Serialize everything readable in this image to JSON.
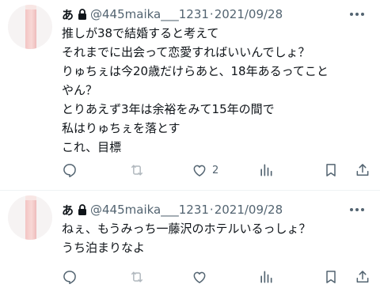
{
  "tweets": [
    {
      "name": "あ",
      "handle": "@445maika___1231",
      "sep": "·",
      "date": "2021/09/28",
      "lines": [
        "推しが38で結婚すると考えて",
        "それまでに出会って恋愛すればいいんでしょ？",
        "りゅちぇは今20歳だけらあと、18年あるってこと",
        "やん？",
        "とりあえず3年は余裕をみて15年の間で",
        "私はりゅちぇを落とす",
        "これ、目標"
      ],
      "like_count": "2"
    },
    {
      "name": "あ",
      "handle": "@445maika___1231",
      "sep": "·",
      "date": "2021/09/28",
      "lines": [
        "ねぇ、もうみっち一藤沢のホテルいるっしょ？",
        "うち泊まりなよ"
      ],
      "like_count": ""
    }
  ],
  "icons": [
    "reply-icon",
    "retweet-icon",
    "like-icon",
    "views-icon",
    "bookmark-icon",
    "share-icon",
    "lock-icon",
    "more-icon"
  ],
  "colors": {
    "muted": "#536471",
    "text": "#0f1419",
    "divider": "#eff3f4"
  }
}
